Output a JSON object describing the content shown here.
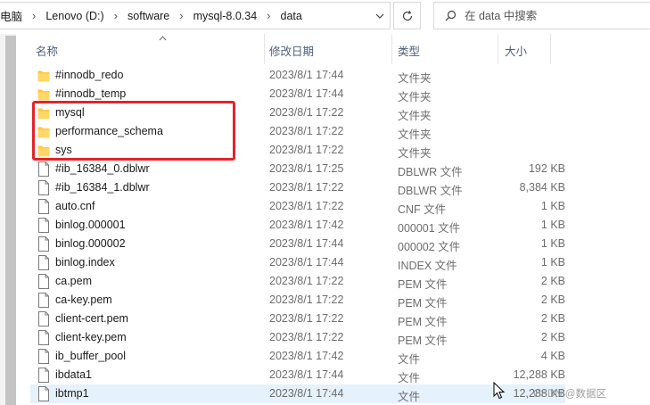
{
  "breadcrumb": {
    "items": [
      {
        "label": "电脑"
      },
      {
        "label": "Lenovo (D:)"
      },
      {
        "label": "software"
      },
      {
        "label": "mysql-8.0.34"
      },
      {
        "label": "data"
      }
    ],
    "separator": "›"
  },
  "search": {
    "placeholder": "在 data 中搜索"
  },
  "columns": {
    "name": "名称",
    "modified": "修改日期",
    "type": "类型",
    "size": "大小"
  },
  "files": [
    {
      "name": "#innodb_redo",
      "modified": "2023/8/1 17:44",
      "type": "文件夹",
      "size": "",
      "kind": "folder"
    },
    {
      "name": "#innodb_temp",
      "modified": "2023/8/1 17:44",
      "type": "文件夹",
      "size": "",
      "kind": "folder"
    },
    {
      "name": "mysql",
      "modified": "2023/8/1 17:22",
      "type": "文件夹",
      "size": "",
      "kind": "folder"
    },
    {
      "name": "performance_schema",
      "modified": "2023/8/1 17:22",
      "type": "文件夹",
      "size": "",
      "kind": "folder"
    },
    {
      "name": "sys",
      "modified": "2023/8/1 17:22",
      "type": "文件夹",
      "size": "",
      "kind": "folder"
    },
    {
      "name": "#ib_16384_0.dblwr",
      "modified": "2023/8/1 17:25",
      "type": "DBLWR 文件",
      "size": "192 KB",
      "kind": "file"
    },
    {
      "name": "#ib_16384_1.dblwr",
      "modified": "2023/8/1 17:22",
      "type": "DBLWR 文件",
      "size": "8,384 KB",
      "kind": "file"
    },
    {
      "name": "auto.cnf",
      "modified": "2023/8/1 17:22",
      "type": "CNF 文件",
      "size": "1 KB",
      "kind": "file"
    },
    {
      "name": "binlog.000001",
      "modified": "2023/8/1 17:42",
      "type": "000001 文件",
      "size": "1 KB",
      "kind": "file"
    },
    {
      "name": "binlog.000002",
      "modified": "2023/8/1 17:44",
      "type": "000002 文件",
      "size": "1 KB",
      "kind": "file"
    },
    {
      "name": "binlog.index",
      "modified": "2023/8/1 17:44",
      "type": "INDEX 文件",
      "size": "1 KB",
      "kind": "file"
    },
    {
      "name": "ca.pem",
      "modified": "2023/8/1 17:22",
      "type": "PEM 文件",
      "size": "2 KB",
      "kind": "file"
    },
    {
      "name": "ca-key.pem",
      "modified": "2023/8/1 17:22",
      "type": "PEM 文件",
      "size": "2 KB",
      "kind": "file"
    },
    {
      "name": "client-cert.pem",
      "modified": "2023/8/1 17:22",
      "type": "PEM 文件",
      "size": "2 KB",
      "kind": "file"
    },
    {
      "name": "client-key.pem",
      "modified": "2023/8/1 17:22",
      "type": "PEM 文件",
      "size": "2 KB",
      "kind": "file"
    },
    {
      "name": "ib_buffer_pool",
      "modified": "2023/8/1 17:42",
      "type": "文件",
      "size": "4 KB",
      "kind": "file"
    },
    {
      "name": "ibdata1",
      "modified": "2023/8/1 17:44",
      "type": "文件",
      "size": "12,288 KB",
      "kind": "file"
    },
    {
      "name": "ibtmp1",
      "modified": "2023/8/1 17:44",
      "type": "文件",
      "size": "12,288 KB",
      "kind": "file",
      "selected": true
    }
  ],
  "watermark": "CSDN @数据区",
  "colors": {
    "folder": "#ffc83d",
    "highlight_box": "#e3242b",
    "selection": "#e5f1fb"
  },
  "icons": {
    "folder": "folder-icon",
    "file": "file-icon",
    "refresh": "refresh-icon",
    "search": "search-icon",
    "dropdown": "chevron-down-icon"
  }
}
